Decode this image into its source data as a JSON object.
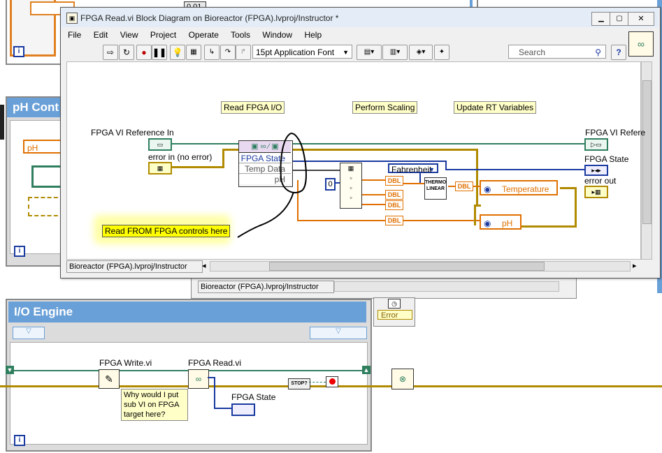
{
  "window": {
    "title": "FPGA Read.vi Block Diagram on Bioreactor (FPGA).lvproj/Instructor *",
    "minimize": "▁",
    "maximize": "▢",
    "close": "✕"
  },
  "menu": [
    "File",
    "Edit",
    "View",
    "Project",
    "Operate",
    "Tools",
    "Window",
    "Help"
  ],
  "toolbar": {
    "font": "15pt Application Font",
    "search_placeholder": "Search",
    "help": "?"
  },
  "diagram": {
    "label_read_io": "Read FPGA I/O",
    "label_scaling": "Perform Scaling",
    "label_update": "Update RT Variables",
    "fpga_ref_in": "FPGA VI Reference In",
    "error_in": "error in (no error)",
    "fpga_ref_out": "FPGA VI Refere",
    "fpga_state_out": "FPGA State",
    "error_out": "error out",
    "node_items": [
      "FPGA State",
      "Temp Data",
      "pH"
    ],
    "fahrenheit": "Fahrenheit",
    "thermo": "THERMO\nLINEAR",
    "dbl": "DBL",
    "temperature": "Temperature",
    "ph": "pH",
    "note": "Read FROM FPGA controls here",
    "constant_zero": "0"
  },
  "status": {
    "front_path": "Bioreactor (FPGA).lvproj/Instructor",
    "back_path": "Bioreactor (FPGA).lvproj/Instructor"
  },
  "background": {
    "ph_control": "pH Cont",
    "ph_label": "pH",
    "io_engine": "I/O Engine",
    "fpga_write": "FPGA Write.vi",
    "fpga_read": "FPGA Read.vi",
    "fpga_state": "FPGA State",
    "question": "Why would I put sub VI on FPGA target here?",
    "error": "Error",
    "stop": "STOP?",
    "counter": "0.01",
    "i": "i"
  },
  "colors": {
    "error_wire": "#b08a00",
    "ref_wire": "#2f7f5f",
    "enum_wire": "#1a3aa0",
    "dbl_wire": "#e07000"
  }
}
